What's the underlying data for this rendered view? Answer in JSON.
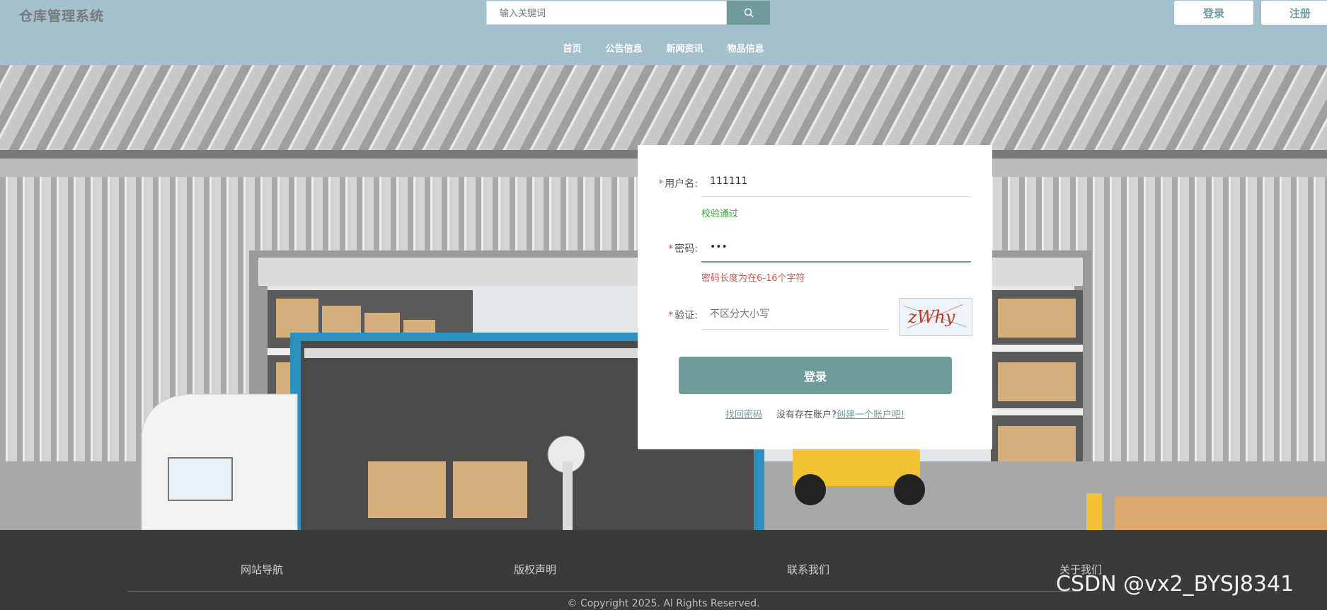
{
  "header": {
    "logo": "仓库管理系统",
    "search_placeholder": "输入关键词",
    "login_label": "登录",
    "register_label": "注册",
    "nav": [
      "首页",
      "公告信息",
      "新闻资讯",
      "物品信息"
    ]
  },
  "form": {
    "username_label": "用户名:",
    "username_value": "111111",
    "username_msg": "校验通过",
    "password_label": "密码:",
    "password_value": "•••",
    "password_msg": "密码长度为在6-16个字符",
    "captcha_label": "验证:",
    "captcha_placeholder": "不区分大小写",
    "captcha_text": "zWhy",
    "submit_label": "登录",
    "forgot_label": "找回密码",
    "no_account_text": "没有存在账户?",
    "create_account_label": "创建一个账户吧!"
  },
  "footer": {
    "cols": [
      "网站导航",
      "版权声明",
      "联系我们",
      "关于我们"
    ],
    "copyright": "© Copyright 2025. Al Rights Reserved."
  },
  "watermark": "CSDN @vx2_BYSJ8341",
  "colors": {
    "header_bg": "#a3c1cc",
    "accent": "#6f9b99",
    "footer_bg": "#3a3a3a",
    "error": "#d9534f",
    "success": "#3aa83a"
  },
  "icons": [
    "search-icon"
  ]
}
